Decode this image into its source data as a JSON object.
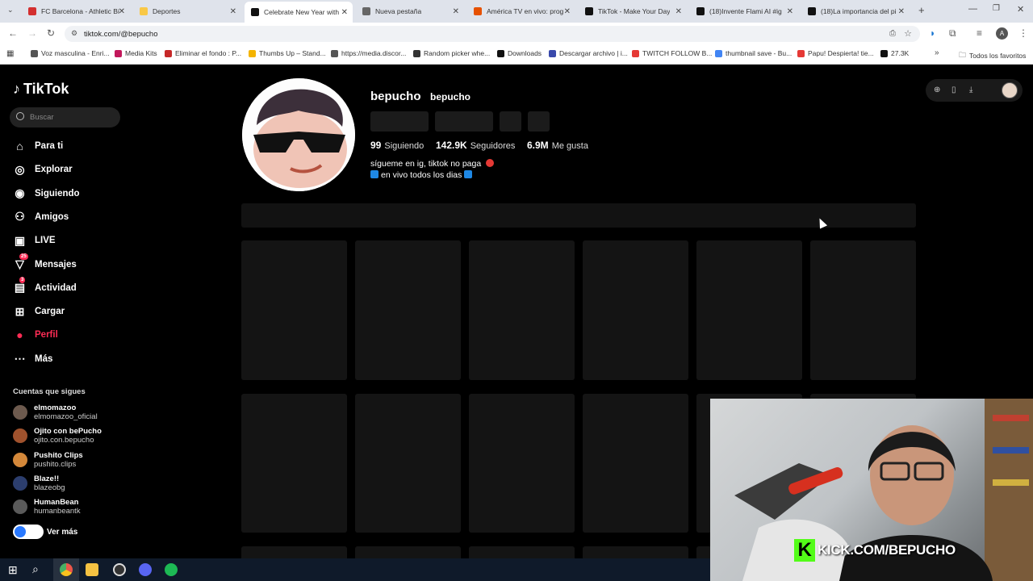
{
  "browser": {
    "tabs": [
      {
        "title": "FC Barcelona - Athletic Bi",
        "color": "#d32f2f"
      },
      {
        "title": "Deportes",
        "color": "#f9c846"
      },
      {
        "title": "Celebrate New Year with",
        "color": "#111111"
      },
      {
        "title": "Nueva pestaña",
        "color": "#666666"
      },
      {
        "title": "América TV en vivo: prog",
        "color": "#e65100"
      },
      {
        "title": "TikTok - Make Your Day",
        "color": "#111111"
      },
      {
        "title": "(18)Invente Flami AI #ig",
        "color": "#111111"
      },
      {
        "title": "(18)La importancia del pi",
        "color": "#111111"
      }
    ],
    "url": "tiktok.com/@bepucho",
    "bookmarks": [
      "Voz masculina - Enri...",
      "Media Kits",
      "Eliminar el fondo : P...",
      "Thumbs Up – Stand...",
      "https://media.discor...",
      "Random picker whe...",
      "Downloads",
      "Descargar archivo | i...",
      "TWITCH FOLLOW B...",
      "thumbnail save - Bu...",
      "Papu! Despierta! tie...",
      "27.3K"
    ],
    "all_bookmarks": "Todos los favoritos"
  },
  "sidebar": {
    "logo": "TikTok",
    "search_placeholder": "Buscar",
    "nav": [
      {
        "label": "Para ti",
        "icon": "home-icon"
      },
      {
        "label": "Explorar",
        "icon": "compass-icon"
      },
      {
        "label": "Siguiendo",
        "icon": "following-icon"
      },
      {
        "label": "Amigos",
        "icon": "friends-icon"
      },
      {
        "label": "LIVE",
        "icon": "live-icon"
      },
      {
        "label": "Mensajes",
        "icon": "messages-icon",
        "badge": "25"
      },
      {
        "label": "Actividad",
        "icon": "activity-icon",
        "badge": "3"
      },
      {
        "label": "Cargar",
        "icon": "upload-icon"
      },
      {
        "label": "Perfil",
        "icon": "profile-icon"
      },
      {
        "label": "Más",
        "icon": "more-icon"
      }
    ],
    "following_title": "Cuentas que sigues",
    "accounts": [
      {
        "name": "elmomazoo",
        "handle": "elmomazoo_oficial"
      },
      {
        "name": "Ojito con bePucho",
        "handle": "ojito.con.bepucho"
      },
      {
        "name": "Pushito Clips",
        "handle": "pushito.clips"
      },
      {
        "name": "Blaze!!",
        "handle": "blazeobg"
      },
      {
        "name": "HumanBean",
        "handle": "humanbeantk"
      }
    ],
    "see_more": "Ver más"
  },
  "profile": {
    "username": "bepucho",
    "nickname": "bepucho",
    "following_count": "99",
    "following_label": "Siguiendo",
    "followers_count": "142.9K",
    "followers_label": "Seguidores",
    "likes_count": "6.9M",
    "likes_label": "Me gusta",
    "bio_line1": "sígueme en ig, tiktok no paga",
    "bio_line2": "en vivo todos los dias"
  },
  "overlay": {
    "stream_url": "KICK.COM/BEPUCHO",
    "kick_letter": "K"
  }
}
